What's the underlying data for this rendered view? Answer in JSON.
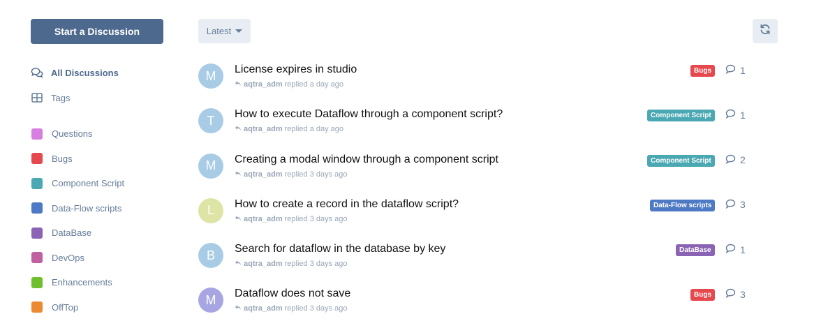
{
  "sidebar": {
    "start_button": "Start a Discussion",
    "nav": [
      {
        "label": "All Discussions",
        "icon": "comments-icon",
        "active": true
      },
      {
        "label": "Tags",
        "icon": "tags-grid-icon",
        "active": false
      }
    ],
    "tags": [
      {
        "label": "Questions",
        "color": "#d77fe0"
      },
      {
        "label": "Bugs",
        "color": "#e5484d"
      },
      {
        "label": "Component Script",
        "color": "#4aa8b3"
      },
      {
        "label": "Data-Flow scripts",
        "color": "#4e79c5"
      },
      {
        "label": "DataBase",
        "color": "#8a63b4"
      },
      {
        "label": "DevOps",
        "color": "#c060a0"
      },
      {
        "label": "Enhancements",
        "color": "#6dbf2b"
      },
      {
        "label": "OffTop",
        "color": "#eb8a30"
      }
    ]
  },
  "toolbar": {
    "sort_label": "Latest",
    "refresh_icon": "refresh-icon"
  },
  "discussions": [
    {
      "avatar": "M",
      "avatar_color": "#a8cbe6",
      "title": "License expires in studio",
      "user": "aqtra_adm",
      "time": "replied a day ago",
      "tag": "Bugs",
      "tag_color": "#e5484d",
      "replies": "1"
    },
    {
      "avatar": "T",
      "avatar_color": "#a8cbe6",
      "title": "How to execute Dataflow through a component script?",
      "user": "aqtra_adm",
      "time": "replied a day ago",
      "tag": "Component Script",
      "tag_color": "#4aa8b3",
      "replies": "1"
    },
    {
      "avatar": "M",
      "avatar_color": "#a8cbe6",
      "title": "Creating a modal window through a component script",
      "user": "aqtra_adm",
      "time": "replied 3 days ago",
      "tag": "Component Script",
      "tag_color": "#4aa8b3",
      "replies": "2"
    },
    {
      "avatar": "L",
      "avatar_color": "#dde4a6",
      "title": "How to create a record in the dataflow script?",
      "user": "aqtra_adm",
      "time": "replied 3 days ago",
      "tag": "Data-Flow scripts",
      "tag_color": "#4e79c5",
      "replies": "3"
    },
    {
      "avatar": "B",
      "avatar_color": "#a8cbe6",
      "title": "Search for dataflow in the database by key",
      "user": "aqtra_adm",
      "time": "replied 3 days ago",
      "tag": "DataBase",
      "tag_color": "#8a63b4",
      "replies": "1"
    },
    {
      "avatar": "M",
      "avatar_color": "#a7a6e3",
      "title": "Dataflow does not save",
      "user": "aqtra_adm",
      "time": "replied 3 days ago",
      "tag": "Bugs",
      "tag_color": "#e5484d",
      "replies": "3"
    }
  ]
}
